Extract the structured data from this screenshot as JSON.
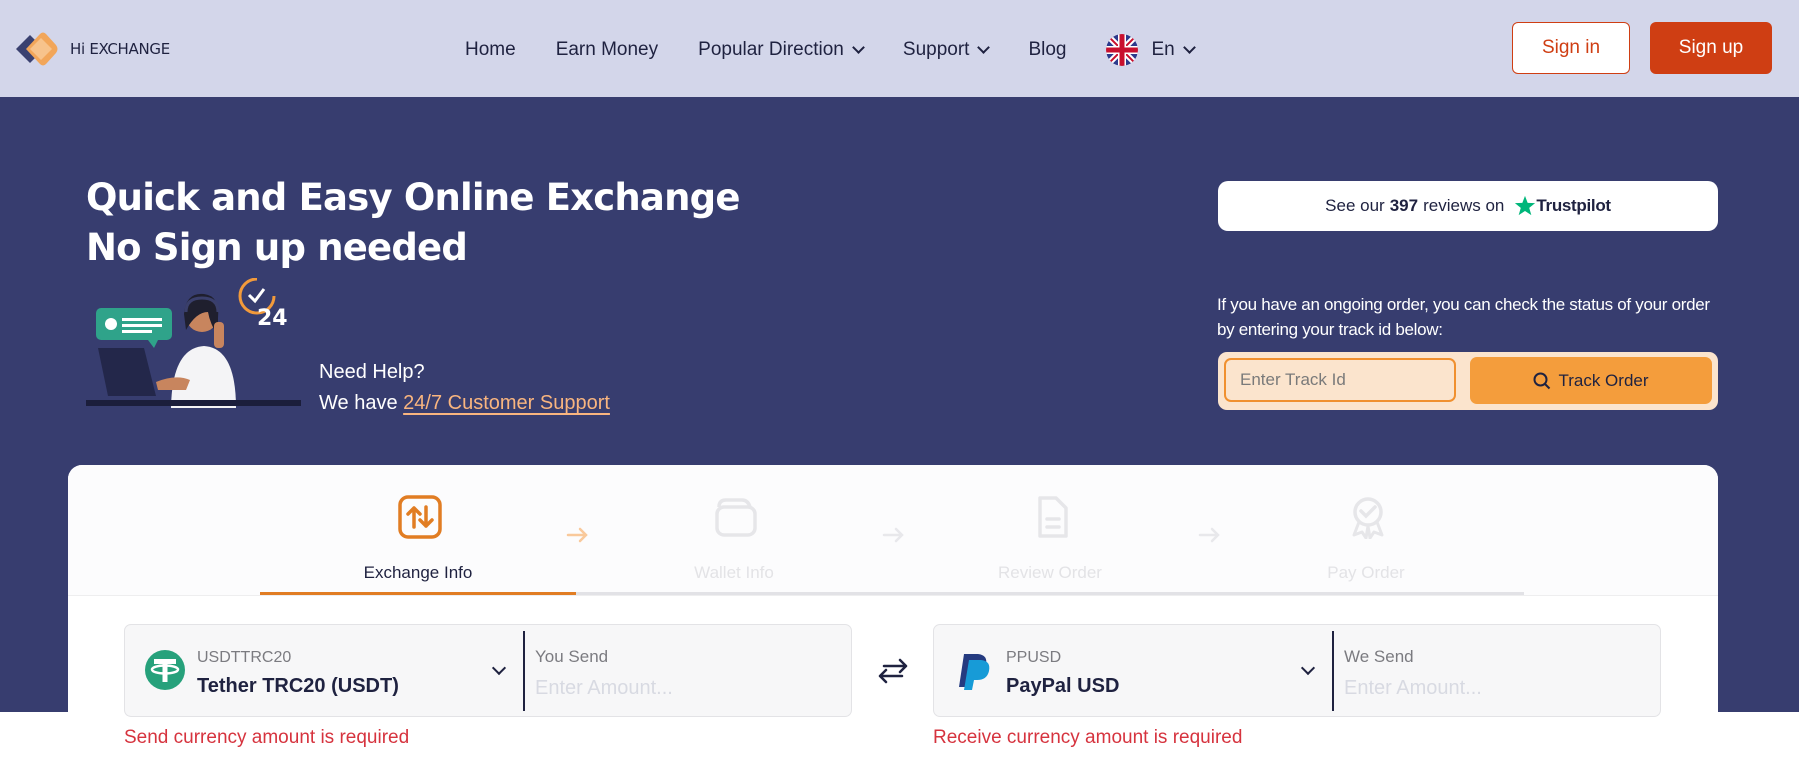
{
  "header": {
    "logo_text": "Hi EXCHANGE",
    "nav": [
      {
        "label": "Home",
        "has_dropdown": false
      },
      {
        "label": "Earn Money",
        "has_dropdown": false
      },
      {
        "label": "Popular Direction",
        "has_dropdown": true
      },
      {
        "label": "Support",
        "has_dropdown": true
      },
      {
        "label": "Blog",
        "has_dropdown": false
      }
    ],
    "language": "En",
    "signin_label": "Sign in",
    "signup_label": "Sign up"
  },
  "hero": {
    "title_line1": "Quick and Easy Online Exchange",
    "title_line2": "No Sign up needed",
    "need_help": "Need Help?",
    "we_have": "We have",
    "support_link": "24/7 Customer Support",
    "support_badge": "24"
  },
  "trustpilot": {
    "prefix": "See our",
    "count": "397",
    "suffix": "reviews on",
    "brand": "Trustpilot"
  },
  "track": {
    "info": "If you have an ongoing order, you can check the status of your order by entering your track id below:",
    "placeholder": "Enter Track Id",
    "button_label": "Track Order"
  },
  "steps": [
    {
      "label": "Exchange Info",
      "active": true
    },
    {
      "label": "Wallet Info",
      "active": false
    },
    {
      "label": "Review Order",
      "active": false
    },
    {
      "label": "Pay Order",
      "active": false
    }
  ],
  "send": {
    "code": "USDTTRC20",
    "name": "Tether TRC20 (USDT)",
    "amount_label": "You Send",
    "placeholder": "Enter Amount...",
    "error": "Send currency amount is required"
  },
  "receive": {
    "code": "PPUSD",
    "name": "PayPal USD",
    "amount_label": "We Send",
    "placeholder": "Enter Amount...",
    "error": "Receive currency amount is required"
  },
  "colors": {
    "header_bg": "#d3d6ea",
    "hero_bg": "#373d6f",
    "brand_red": "#cf3e13",
    "accent_orange": "#f49d3c",
    "error_red": "#d6333e"
  }
}
